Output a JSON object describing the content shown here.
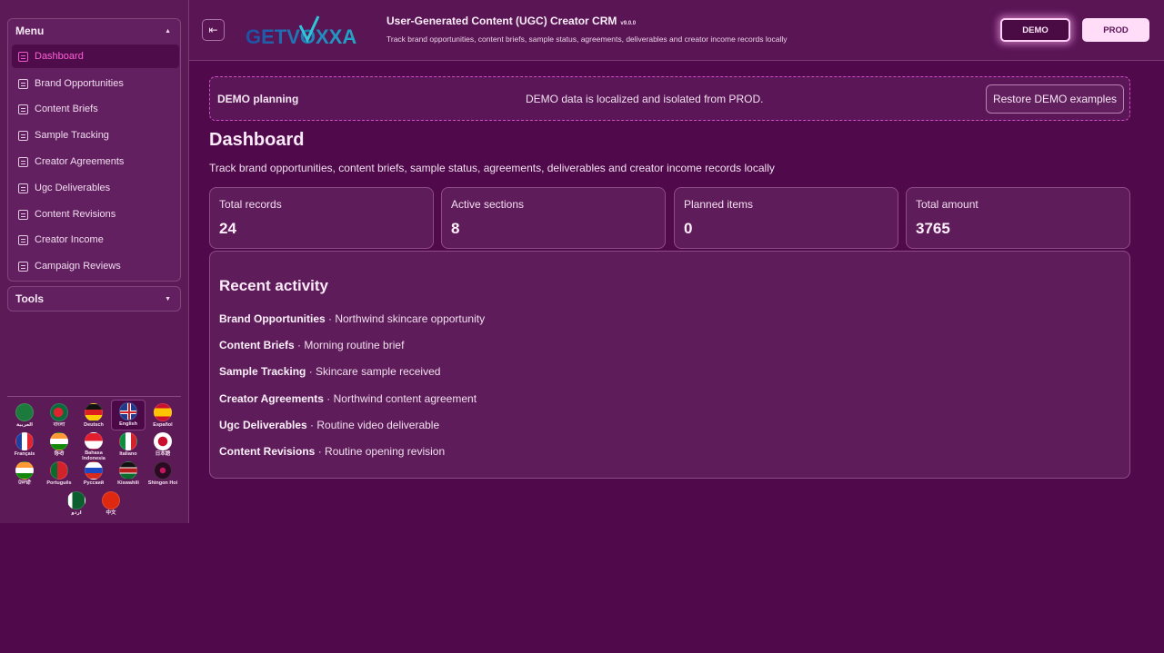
{
  "sidebar": {
    "menu_label": "Menu",
    "tools_label": "Tools",
    "items": [
      {
        "label": "Dashboard"
      },
      {
        "label": "Brand Opportunities"
      },
      {
        "label": "Content Briefs"
      },
      {
        "label": "Sample Tracking"
      },
      {
        "label": "Creator Agreements"
      },
      {
        "label": "Ugc Deliverables"
      },
      {
        "label": "Content Revisions"
      },
      {
        "label": "Creator Income"
      },
      {
        "label": "Campaign Reviews"
      }
    ],
    "languages": [
      {
        "name": "العربية"
      },
      {
        "name": "বাংলা"
      },
      {
        "name": "Deutsch"
      },
      {
        "name": "English"
      },
      {
        "name": "Español"
      },
      {
        "name": "Français"
      },
      {
        "name": "हिन्दी"
      },
      {
        "name": "Bahasa Indonesia"
      },
      {
        "name": "Italiano"
      },
      {
        "name": "日本語"
      },
      {
        "name": "ਪੰਜਾਬੀ"
      },
      {
        "name": "Português"
      },
      {
        "name": "Русский"
      },
      {
        "name": "Kiswahili"
      },
      {
        "name": "Shingon Hoi"
      },
      {
        "name": "اردو"
      },
      {
        "name": "中文"
      }
    ]
  },
  "header": {
    "logo_text": "GETVOXXA",
    "title": "User-Generated Content (UGC) Creator CRM",
    "version": "v9.0.0",
    "subtitle": "Track brand opportunities, content briefs, sample status, agreements, deliverables and creator income records locally",
    "demo_label": "DEMO",
    "prod_label": "PROD"
  },
  "banner": {
    "title": "DEMO planning",
    "message": "DEMO data is localized and isolated from PROD.",
    "restore_label": "Restore DEMO examples"
  },
  "main": {
    "title": "Dashboard",
    "subtitle": "Track brand opportunities, content briefs, sample status, agreements, deliverables and creator income records locally",
    "stats": [
      {
        "label": "Total records",
        "value": "24"
      },
      {
        "label": "Active sections",
        "value": "8"
      },
      {
        "label": "Planned items",
        "value": "0"
      },
      {
        "label": "Total amount",
        "value": "3765"
      }
    ],
    "activity_title": "Recent activity",
    "activity": [
      {
        "section": "Brand Opportunities",
        "sep": " · ",
        "text": "Northwind skincare opportunity"
      },
      {
        "section": "Content Briefs",
        "sep": " · ",
        "text": "Morning routine brief"
      },
      {
        "section": "Sample Tracking",
        "sep": " · ",
        "text": "Skincare sample received"
      },
      {
        "section": "Creator Agreements",
        "sep": " · ",
        "text": "Northwind content agreement"
      },
      {
        "section": "Ugc Deliverables",
        "sep": " · ",
        "text": "Routine video deliverable"
      },
      {
        "section": "Content Revisions",
        "sep": " · ",
        "text": "Routine opening revision"
      }
    ]
  },
  "colors": {
    "background": "#500a4c",
    "accent": "#ff5fd6",
    "panel": "#5e1c5a"
  }
}
